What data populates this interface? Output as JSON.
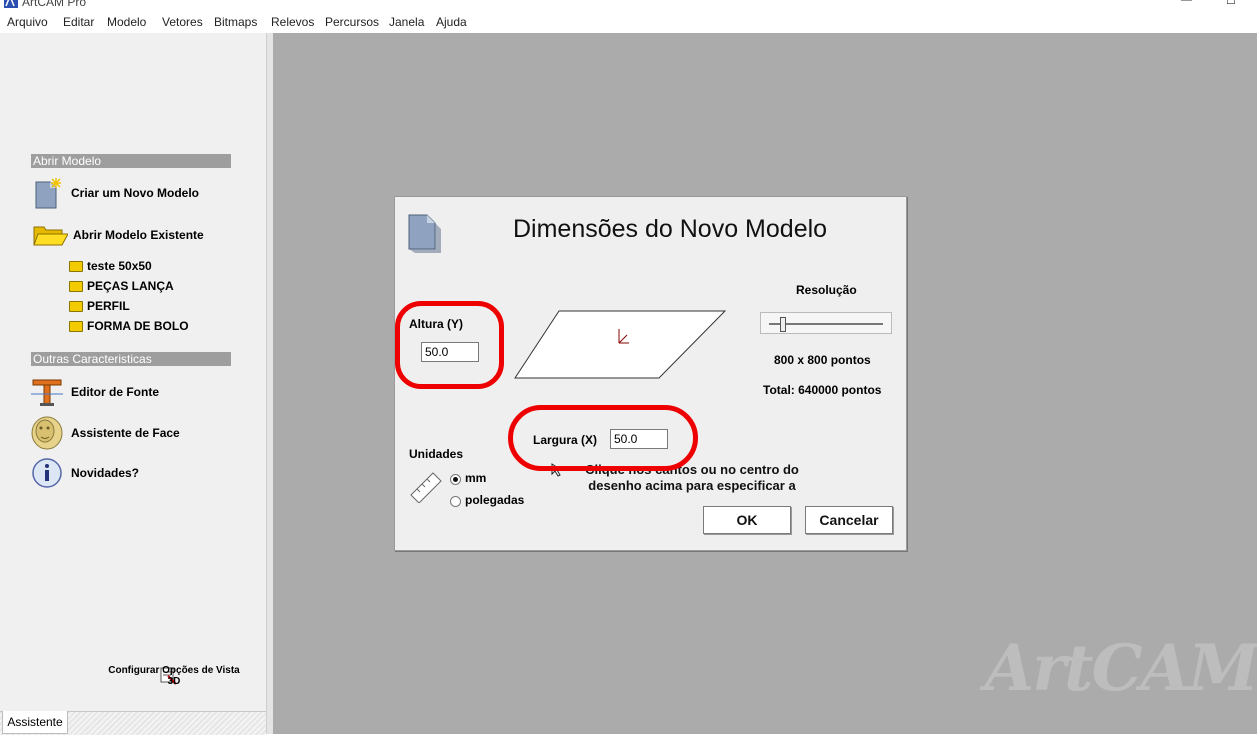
{
  "app": {
    "title": "ArtCAM Pro"
  },
  "menu": [
    "Arquivo",
    "Editar",
    "Modelo",
    "Vetores",
    "Bitmaps",
    "Relevos",
    "Percursos",
    "Janela",
    "Ajuda"
  ],
  "sidebar": {
    "section_open": "Abrir Modelo",
    "new_model": "Criar um Novo Modelo",
    "open_existing": "Abrir Modelo Existente",
    "recent": [
      "teste 50x50",
      "PEÇAS LANÇA",
      "PERFIL",
      "FORMA DE BOLO"
    ],
    "section_other": "Outras Caracteristicas",
    "font_editor": "Editor de Fonte",
    "face_assistant": "Assistente de Face",
    "news": "Novidades?",
    "config_3d": "Configurar Opções de Vista 3D",
    "tab": "Assistente"
  },
  "dialog": {
    "title": "Dimensões do Novo Modelo",
    "height_label": "Altura (Y)",
    "height_value": "50.0",
    "width_label": "Largura (X)",
    "width_value": "50.0",
    "resolution_label": "Resolução",
    "resolution_level": 0.1,
    "points": "800 x 800 pontos",
    "total": "Total: 640000 pontos",
    "units_label": "Unidades",
    "unit_mm": "mm",
    "unit_inches": "polegadas",
    "selected_unit": "mm",
    "hint": "Clique nos cantos ou no centro do desenho acima para especificar a",
    "ok": "OK",
    "cancel": "Cancelar"
  },
  "watermark": "ArtCAM",
  "colors": {
    "workspace": "#ababab",
    "panel": "#f0f0f0",
    "section": "#9e9e9e",
    "annotation": "#ee0000"
  }
}
